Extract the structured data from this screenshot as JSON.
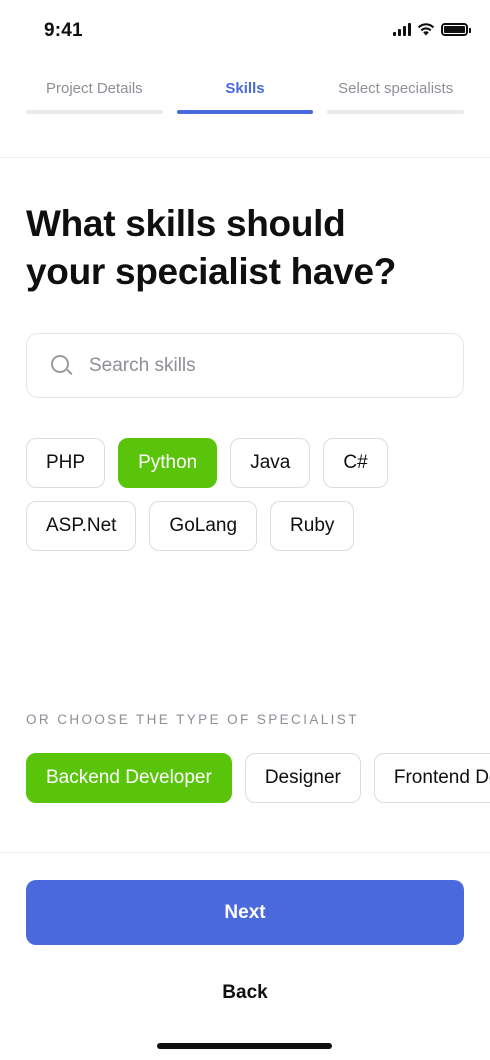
{
  "status": {
    "time": "9:41"
  },
  "stepper": {
    "steps": [
      {
        "label": "Project Details",
        "active": false
      },
      {
        "label": "Skills",
        "active": true
      },
      {
        "label": "Select specialists",
        "active": false
      }
    ]
  },
  "title": {
    "line1": "What skills should",
    "line2": "your specialist have?"
  },
  "search": {
    "placeholder": "Search skills",
    "value": ""
  },
  "skills": [
    {
      "label": "PHP",
      "selected": false
    },
    {
      "label": "Python",
      "selected": true
    },
    {
      "label": "Java",
      "selected": false
    },
    {
      "label": "C#",
      "selected": false
    },
    {
      "label": "ASP.Net",
      "selected": false
    },
    {
      "label": "GoLang",
      "selected": false
    },
    {
      "label": "Ruby",
      "selected": false
    }
  ],
  "specialist_section_label": "OR CHOOSE THE TYPE OF SPECIALIST",
  "specialist_types": [
    {
      "label": "Backend Developer",
      "selected": true
    },
    {
      "label": "Designer",
      "selected": false
    },
    {
      "label": "Frontend Developer",
      "selected": false
    }
  ],
  "actions": {
    "next_label": "Next",
    "back_label": "Back"
  },
  "colors": {
    "accent": "#4a69dd",
    "selected_chip": "#5ac40b",
    "muted_text": "#8e8f96"
  }
}
